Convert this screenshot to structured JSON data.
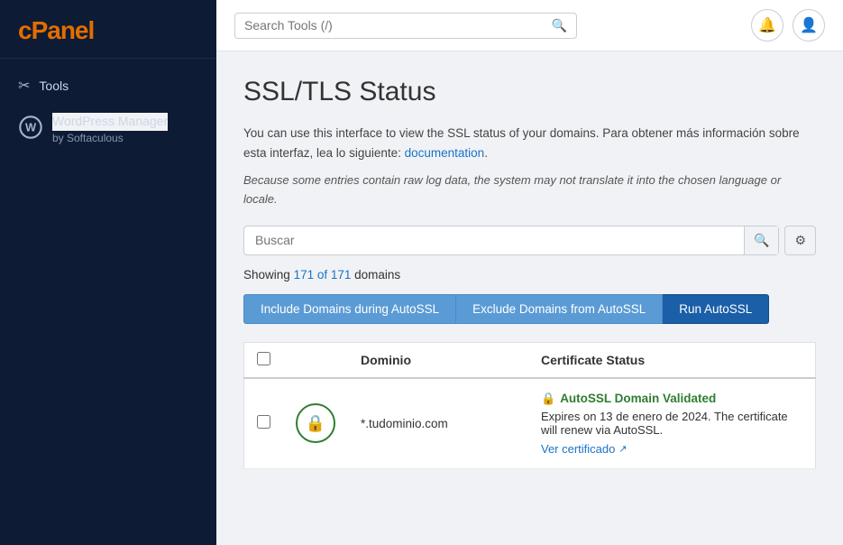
{
  "sidebar": {
    "logo": {
      "prefix": "c",
      "brand": "Panel"
    },
    "items": [
      {
        "id": "tools",
        "label": "Tools",
        "icon": "✂"
      },
      {
        "id": "wordpress-manager",
        "label": "WordPress Manager",
        "sub": "by Softaculous"
      }
    ]
  },
  "topbar": {
    "search": {
      "placeholder": "Search Tools (/)"
    },
    "bell_label": "Notifications",
    "user_label": "User"
  },
  "page": {
    "title": "SSL/TLS Status",
    "description": "You can use this interface to view the SSL status of your domains. Para obtener más información sobre esta interfaz, lea lo siguiente:",
    "doc_link_text": "documentation",
    "italic_note": "Because some entries contain raw log data, the system may not translate it into the chosen language or locale.",
    "filter_placeholder": "Buscar",
    "showing_prefix": "Showing",
    "showing_count": "171 of 171",
    "showing_suffix": "domains",
    "btn_include": "Include Domains during AutoSSL",
    "btn_exclude": "Exclude Domains from AutoSSL",
    "btn_run": "Run AutoSSL",
    "table": {
      "col_domain": "Dominio",
      "col_status": "Certificate Status",
      "rows": [
        {
          "domain": "*.tudominio.com",
          "status_label": "AutoSSL Domain Validated",
          "expiry": "Expires on 13 de enero de 2024. The certificate will renew via AutoSSL.",
          "view_cert": "Ver certificado"
        }
      ]
    }
  }
}
